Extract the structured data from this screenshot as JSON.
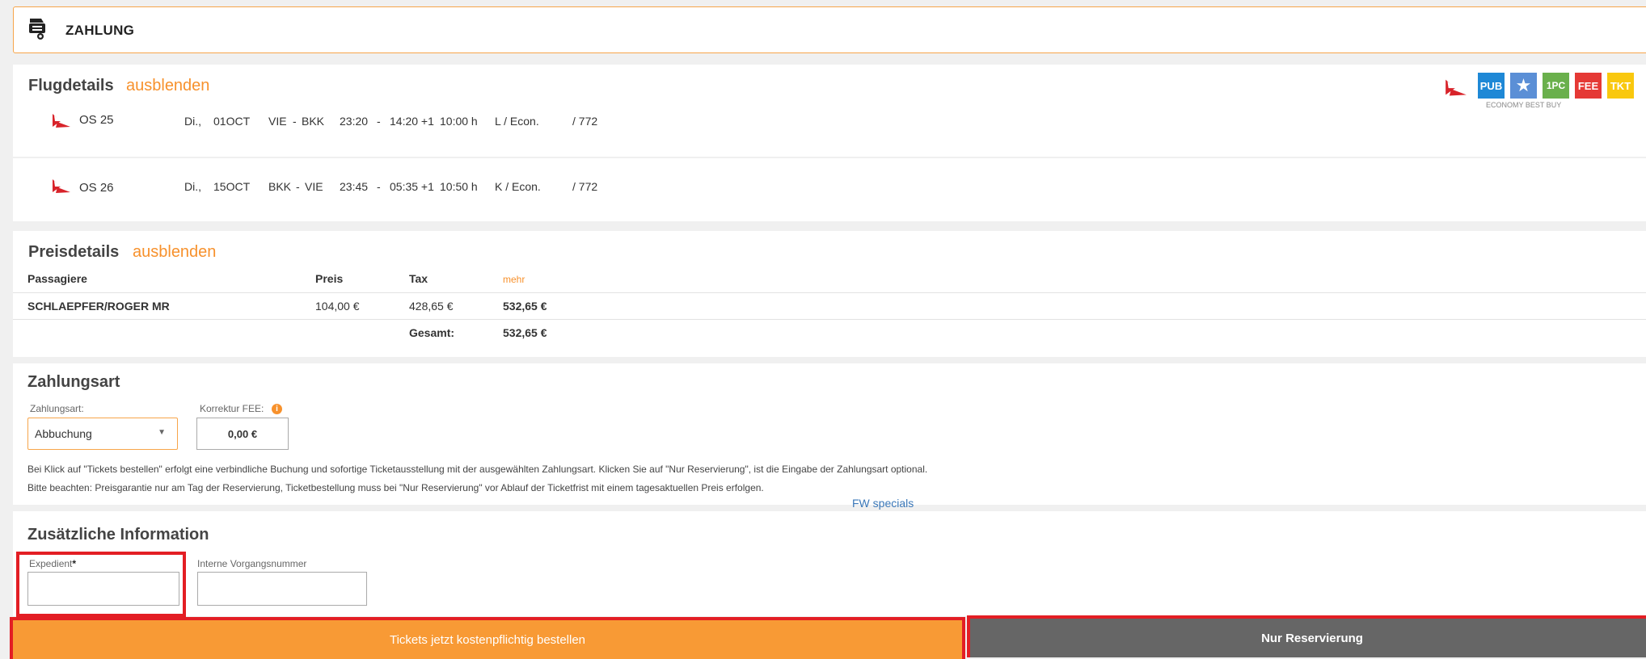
{
  "header": {
    "title": "ZAHLUNG",
    "icon": "ticket-printer-icon"
  },
  "flight_details": {
    "title": "Flugdetails",
    "toggle": "ausblenden",
    "flights": [
      {
        "number": "OS 25",
        "day": "Di.,",
        "date": "01OCT",
        "from": "VIE",
        "sep": "-",
        "to": "BKK",
        "dep": "23:20",
        "dash": "-",
        "arr": "14:20 +1",
        "duration": "10:00 h",
        "class": "L / Econ.",
        "aircraft": "/ 772"
      },
      {
        "number": "OS 26",
        "day": "Di.,",
        "date": "15OCT",
        "from": "BKK",
        "sep": "-",
        "to": "VIE",
        "dep": "23:45",
        "dash": "-",
        "arr": "05:35 +1",
        "duration": "10:50 h",
        "class": "K / Econ.",
        "aircraft": "/ 772"
      }
    ],
    "badges": [
      {
        "label": "PUB",
        "color": "#1e88d6"
      },
      {
        "label": "★",
        "color": "#5b8fd6"
      },
      {
        "label": "1PC",
        "color": "#6ab04c"
      },
      {
        "label": "FEE",
        "color": "#e53935"
      },
      {
        "label": "TKT",
        "color": "#f9c80e"
      }
    ],
    "fare_family": "ECONOMY BEST BUY"
  },
  "price_details": {
    "title": "Preisdetails",
    "toggle": "ausblenden",
    "headers": {
      "passenger": "Passagiere",
      "price": "Preis",
      "tax": "Tax",
      "more": "mehr"
    },
    "rows": [
      {
        "passenger": "SCHLAEPFER/ROGER MR",
        "price": "104,00 €",
        "tax": "428,65 €",
        "total": "532,65 €"
      }
    ],
    "total_label": "Gesamt:",
    "total_value": "532,65 €"
  },
  "payment": {
    "title": "Zahlungsart",
    "method_label": "Zahlungsart:",
    "method_value": "Abbuchung",
    "fee_label": "Korrektur FEE:",
    "fee_value": "0,00 €",
    "note1": "Bei Klick auf \"Tickets bestellen\" erfolgt eine verbindliche Buchung und sofortige Ticketausstellung mit der ausgewählten Zahlungsart. Klicken Sie auf \"Nur Reservierung\", ist die Eingabe der Zahlungsart optional.",
    "note2": "Bitte beachten: Preisgarantie nur am Tag der Reservierung, Ticketbestellung muss bei \"Nur Reservierung\" vor Ablauf der Ticketfrist mit einem tagesaktuellen Preis erfolgen."
  },
  "fw_specials": "FW specials",
  "additional": {
    "title": "Zusätzliche Information",
    "expedient_label": "Expedient",
    "required_mark": "*",
    "expedient_value": "",
    "internal_label": "Interne Vorgangsnummer",
    "internal_value": ""
  },
  "actions": {
    "order": "Tickets jetzt kostenpflichtig bestellen",
    "reserve": "Nur Reservierung"
  },
  "colors": {
    "accent": "#f7912c",
    "highlight": "#e31e24",
    "reserve_bg": "#666666"
  }
}
